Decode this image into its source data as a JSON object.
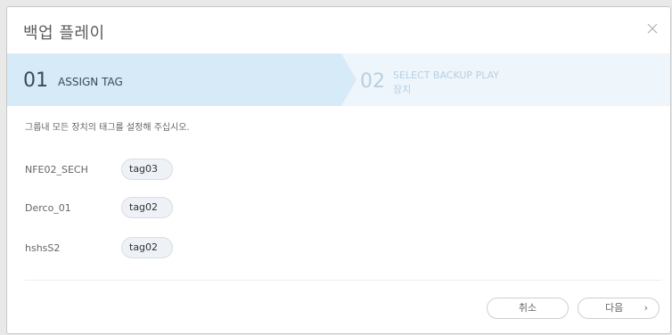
{
  "dialog": {
    "title": "백업 플레이"
  },
  "steps": {
    "step1": {
      "number": "01",
      "label": "ASSIGN TAG"
    },
    "step2": {
      "number": "02",
      "label_line1": "SELECT BACKUP PLAY",
      "label_line2": "장치"
    }
  },
  "description": "그룹내 모든 장치의 태그를 설정해 주십시오.",
  "devices": [
    {
      "name": "NFE02_SECH",
      "tag": "tag03"
    },
    {
      "name": "Derco_01",
      "tag": "tag02"
    },
    {
      "name": "hshsS2",
      "tag": "tag02"
    }
  ],
  "footer": {
    "cancel_label": "취소",
    "next_label": "다음",
    "next_chevron": "›"
  },
  "icons": {
    "close": "close-icon"
  },
  "colors": {
    "active_step_bg": "#d6eaf8",
    "inactive_step_bg": "#eef6fc"
  }
}
